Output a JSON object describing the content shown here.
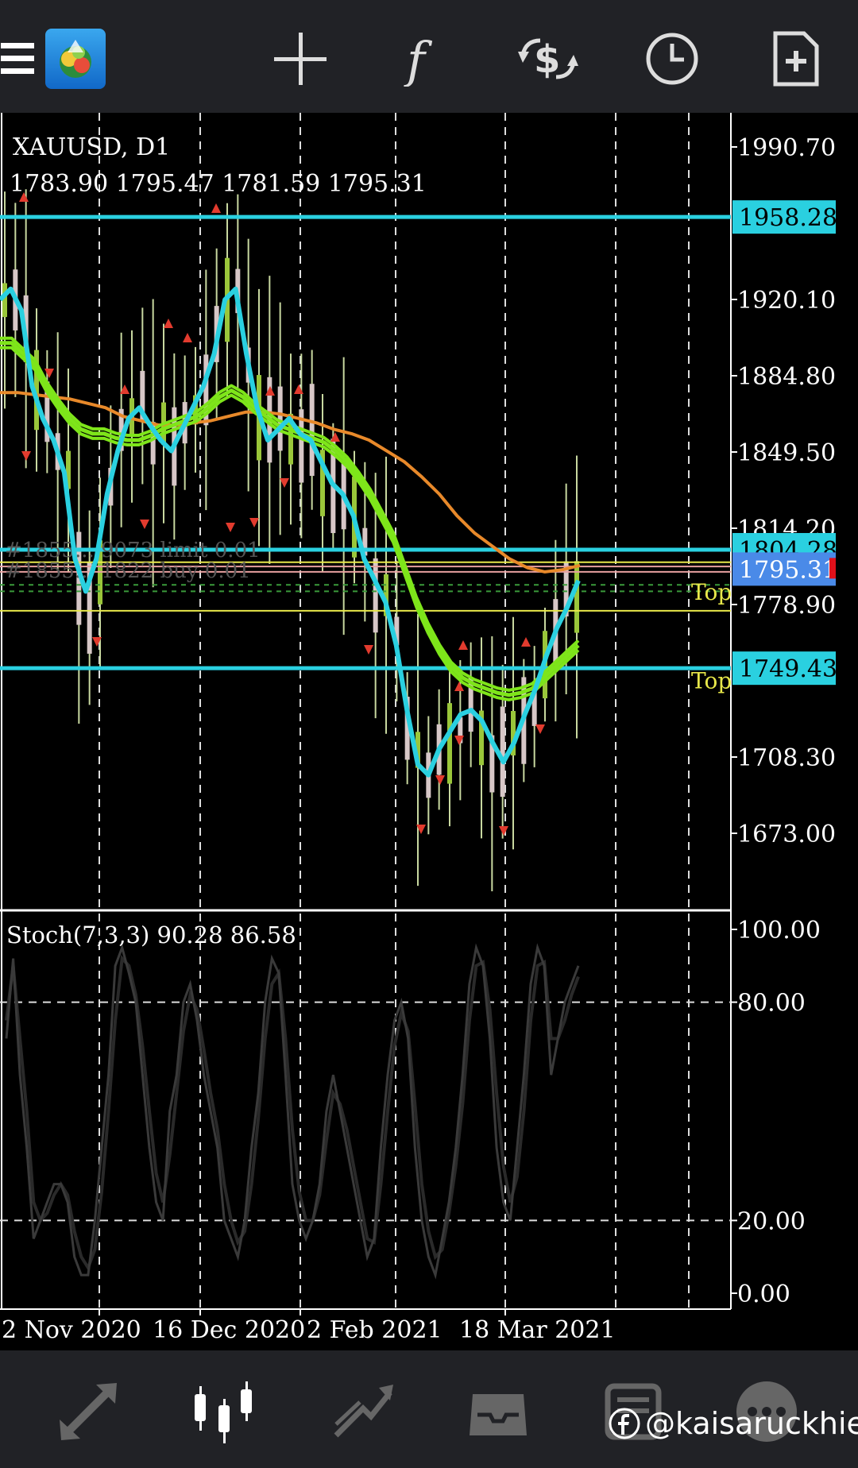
{
  "toolbar": {
    "menu_icon": "hamburger-icon",
    "app_icon": "metatrader-logo",
    "buttons": [
      "crosshair-icon",
      "function-icon",
      "trade-dollar-icon",
      "clock-icon",
      "new-document-icon"
    ]
  },
  "header": {
    "symbol": "XAUUSD, D1",
    "ohlc": "1783.90 1795.47 1781.59 1795.31"
  },
  "price_axis": [
    "1990.70",
    "1920.10",
    "1884.80",
    "1849.50",
    "1814.20",
    "1778.90",
    "1708.30",
    "1673.00"
  ],
  "levels": {
    "resistance": "1958.28",
    "upper": "1804.28",
    "current": "1795.31",
    "support": "1749.43"
  },
  "order_labels": [
    "#1855... 9073 limit 0.01",
    "#1855... 1822 buy 0.01"
  ],
  "top_labels": [
    "Top",
    "Top"
  ],
  "stochastic": {
    "label": "Stoch(7,3,3) 90.28 86.58",
    "axis": [
      "100.00",
      "80.00",
      "20.00",
      "0.00"
    ]
  },
  "time_axis": [
    "2 Nov 2020",
    "16 Dec 2020",
    "2 Feb 2021",
    "18 Mar 2021"
  ],
  "bottom_nav": [
    "quotes-arrows-icon",
    "chart-candles-icon",
    "trade-icon",
    "inbox-icon",
    "news-icon",
    "chat-icon"
  ],
  "watermark": "@kaisaruckhie",
  "colors": {
    "cyan": "#2ad0e0",
    "lime": "#7ee51a",
    "orange": "#e8892a",
    "yellow": "#e8e84a",
    "red": "#e23b2e",
    "current_bg": "#4a8ae8"
  },
  "chart_data": {
    "type": "candlestick",
    "symbol": "XAUUSD",
    "timeframe": "D1",
    "ylim": [
      1640,
      2010
    ],
    "ma_fast": [
      1920,
      1925,
      1915,
      1880,
      1865,
      1855,
      1840,
      1800,
      1785,
      1800,
      1830,
      1850,
      1865,
      1870,
      1862,
      1855,
      1850,
      1860,
      1870,
      1880,
      1895,
      1920,
      1925,
      1895,
      1870,
      1855,
      1860,
      1865,
      1858,
      1855,
      1845,
      1835,
      1830,
      1820,
      1800,
      1790,
      1780,
      1760,
      1730,
      1705,
      1700,
      1712,
      1720,
      1728,
      1730,
      1725,
      1715,
      1706,
      1715,
      1728,
      1740,
      1755,
      1768,
      1778,
      1790
    ],
    "ma_green": [
      1900,
      1900,
      1895,
      1890,
      1880,
      1872,
      1865,
      1860,
      1858,
      1858,
      1856,
      1855,
      1855,
      1857,
      1860,
      1862,
      1864,
      1866,
      1870,
      1875,
      1878,
      1875,
      1870,
      1866,
      1862,
      1860,
      1858,
      1856,
      1854,
      1850,
      1845,
      1838,
      1830,
      1820,
      1810,
      1795,
      1780,
      1768,
      1758,
      1750,
      1745,
      1742,
      1740,
      1738,
      1737,
      1738,
      1740,
      1745,
      1750,
      1755,
      1760
    ],
    "ma_orange": [
      1877,
      1877,
      1876,
      1875,
      1874,
      1872,
      1870,
      1866,
      1864,
      1862,
      1862,
      1863,
      1864,
      1866,
      1868,
      1868,
      1867,
      1865,
      1863,
      1860,
      1858,
      1855,
      1850,
      1845,
      1838,
      1830,
      1820,
      1812,
      1806,
      1800,
      1796,
      1794,
      1795,
      1797
    ],
    "stoch_k": [
      70,
      92,
      60,
      40,
      15,
      20,
      25,
      30,
      30,
      25,
      10,
      5,
      5,
      20,
      40,
      60,
      90,
      95,
      88,
      80,
      60,
      40,
      25,
      20,
      50,
      60,
      80,
      85,
      75,
      60,
      50,
      40,
      20,
      15,
      10,
      20,
      40,
      55,
      80,
      92,
      88,
      60,
      30,
      20,
      15,
      20,
      30,
      50,
      60,
      50,
      40,
      30,
      20,
      10,
      15,
      40,
      60,
      75,
      80,
      70,
      40,
      20,
      10,
      5,
      15,
      25,
      40,
      60,
      85,
      95,
      90,
      70,
      40,
      25,
      20,
      40,
      60,
      85,
      95,
      90,
      60,
      70,
      80,
      85,
      90
    ],
    "stoch_d": [
      75,
      90,
      70,
      50,
      25,
      20,
      22,
      27,
      30,
      27,
      17,
      10,
      7,
      12,
      28,
      50,
      75,
      92,
      90,
      82,
      68,
      50,
      33,
      25,
      38,
      55,
      72,
      82,
      78,
      67,
      55,
      45,
      30,
      20,
      14,
      17,
      30,
      48,
      70,
      85,
      88,
      70,
      45,
      28,
      20,
      20,
      27,
      42,
      55,
      52,
      45,
      35,
      25,
      15,
      14,
      30,
      50,
      68,
      77,
      72,
      52,
      30,
      17,
      10,
      12,
      22,
      35,
      52,
      75,
      90,
      91,
      78,
      55,
      35,
      25,
      32,
      50,
      75,
      90,
      91,
      70,
      70,
      75,
      82,
      87
    ]
  }
}
